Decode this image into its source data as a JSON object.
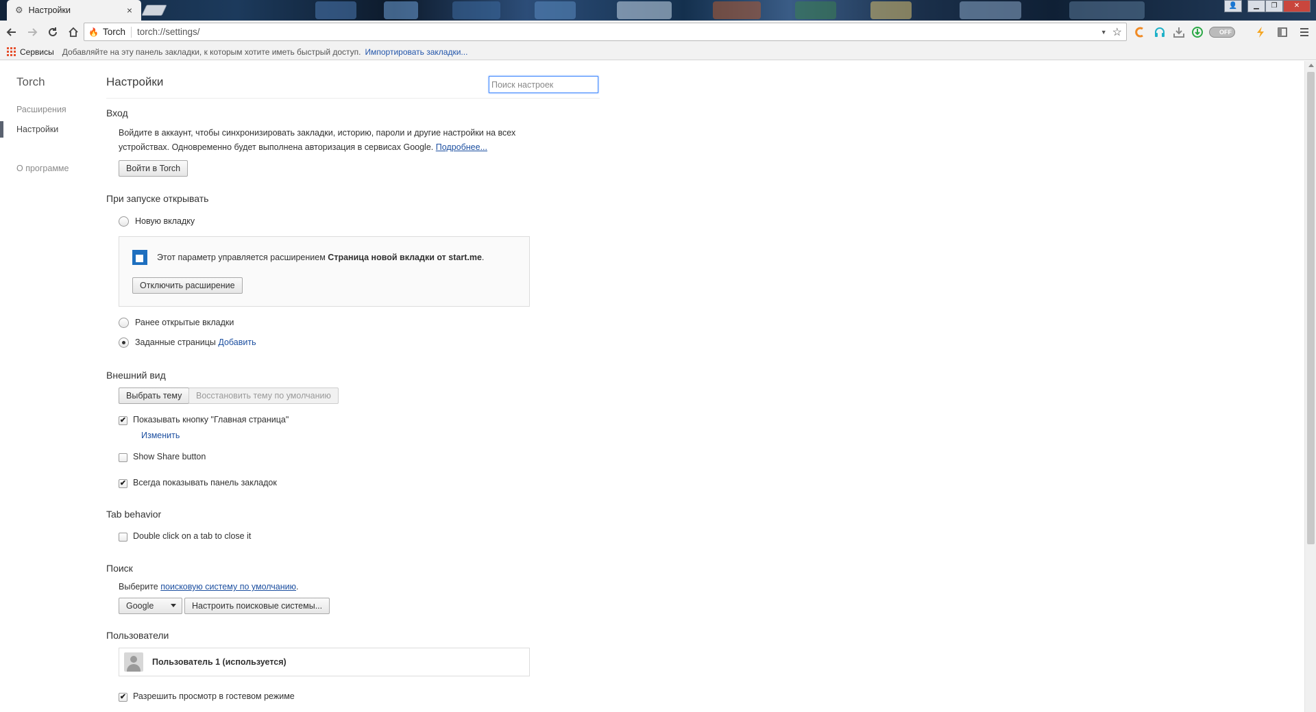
{
  "window": {
    "tab_title": "Настройки",
    "tab_close": "×",
    "controls": {
      "user": "👤",
      "minimize": "▁",
      "maximize": "❐",
      "close": "✕"
    }
  },
  "toolbar": {
    "site_name": "Torch",
    "url": "torch://settings/",
    "ext_toggle": "OFF"
  },
  "bookmarks_bar": {
    "apps_label": "Сервисы",
    "hint": "Добавляйте на эту панель закладки, к которым хотите иметь быстрый доступ.",
    "import_link": "Импортировать закладки..."
  },
  "sidebar": {
    "title": "Torch",
    "items": [
      {
        "label": "Расширения",
        "active": false
      },
      {
        "label": "Настройки",
        "active": true
      },
      {
        "label": "О программе",
        "active": false
      }
    ]
  },
  "header": {
    "title": "Настройки",
    "search_placeholder": "Поиск настроек"
  },
  "signin": {
    "title": "Вход",
    "line1": "Войдите в аккаунт, чтобы синхронизировать закладки, историю, пароли и другие настройки на всех",
    "line2": "устройствах. Одновременно будет выполнена авторизация в сервисах Google.",
    "more_link": "Подробнее...",
    "button": "Войти в Torch"
  },
  "startup": {
    "title": "При запуске открывать",
    "options": [
      {
        "label": "Новую вкладку",
        "selected": false
      },
      {
        "label": "Ранее открытые вкладки",
        "selected": false
      },
      {
        "label": "Заданные страницы",
        "selected": true
      }
    ],
    "add_link": "Добавить",
    "managed_text": "Этот параметр управляется расширением",
    "managed_ext": "Страница новой вкладки от start.me",
    "managed_period": ".",
    "disable_button": "Отключить расширение"
  },
  "appearance": {
    "title": "Внешний вид",
    "choose_theme": "Выбрать тему",
    "reset_theme": "Восстановить тему по умолчанию",
    "show_home": {
      "label": "Показывать кнопку \"Главная страница\"",
      "checked": true
    },
    "change_link": "Изменить",
    "show_share": {
      "label": "Show Share button",
      "checked": false
    },
    "show_bookmarks": {
      "label": "Всегда показывать панель закладок",
      "checked": true
    }
  },
  "tab_behavior": {
    "title": "Tab behavior",
    "double_click": {
      "label": "Double click on a tab to close it",
      "checked": false
    }
  },
  "search": {
    "title": "Поиск",
    "prefix": "Выберите",
    "link": "поисковую систему по умолчанию",
    "suffix": ".",
    "engine": "Google",
    "manage_button": "Настроить поисковые системы..."
  },
  "users": {
    "title": "Пользователи",
    "current_user": "Пользователь 1 (используется)",
    "guest": {
      "label": "Разрешить просмотр в гостевом режиме",
      "checked": true
    }
  },
  "check_mark": "✔"
}
